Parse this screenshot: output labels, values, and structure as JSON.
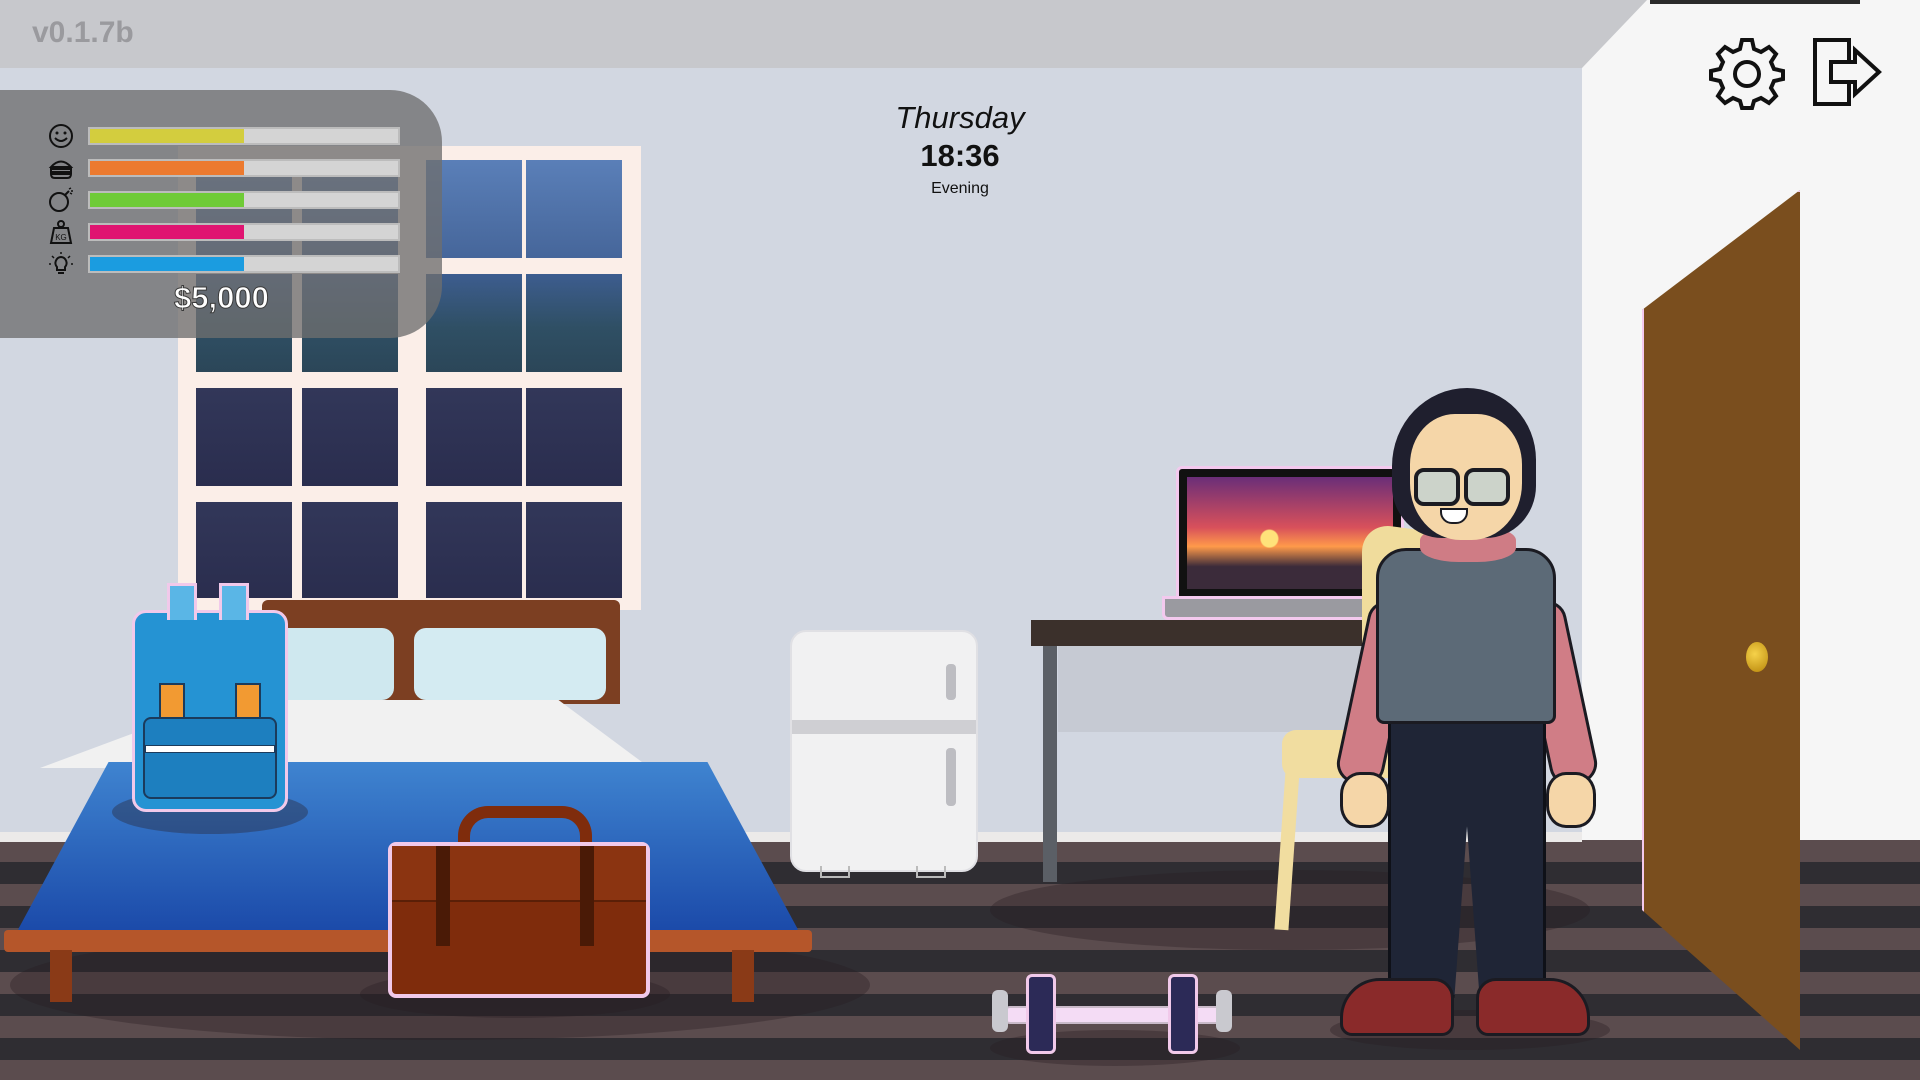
{
  "game": {
    "version": "v0.1.7b"
  },
  "clock": {
    "day": "Thursday",
    "time": "18:36",
    "period": "Evening"
  },
  "stats": [
    {
      "icon": "happiness-face-icon",
      "level_percent": 50,
      "color": "#d3cd3e"
    },
    {
      "icon": "hunger-burger-icon",
      "level_percent": 50,
      "color": "#ec7a2f"
    },
    {
      "icon": "energy-bomb-icon",
      "level_percent": 50,
      "color": "#6fcb37"
    },
    {
      "icon": "weight-kg-icon",
      "level_percent": 50,
      "color": "#e01471"
    },
    {
      "icon": "intelligence-bulb-icon",
      "level_percent": 50,
      "color": "#1b9ce0"
    }
  ],
  "money": "$5,000",
  "buttons": {
    "settings_icon": "gear-icon",
    "exit_icon": "exit-door-icon"
  },
  "scene": {
    "interactive_objects": [
      "backpack",
      "suitcase",
      "fridge",
      "laptop",
      "dumbbell",
      "door",
      "character"
    ]
  }
}
